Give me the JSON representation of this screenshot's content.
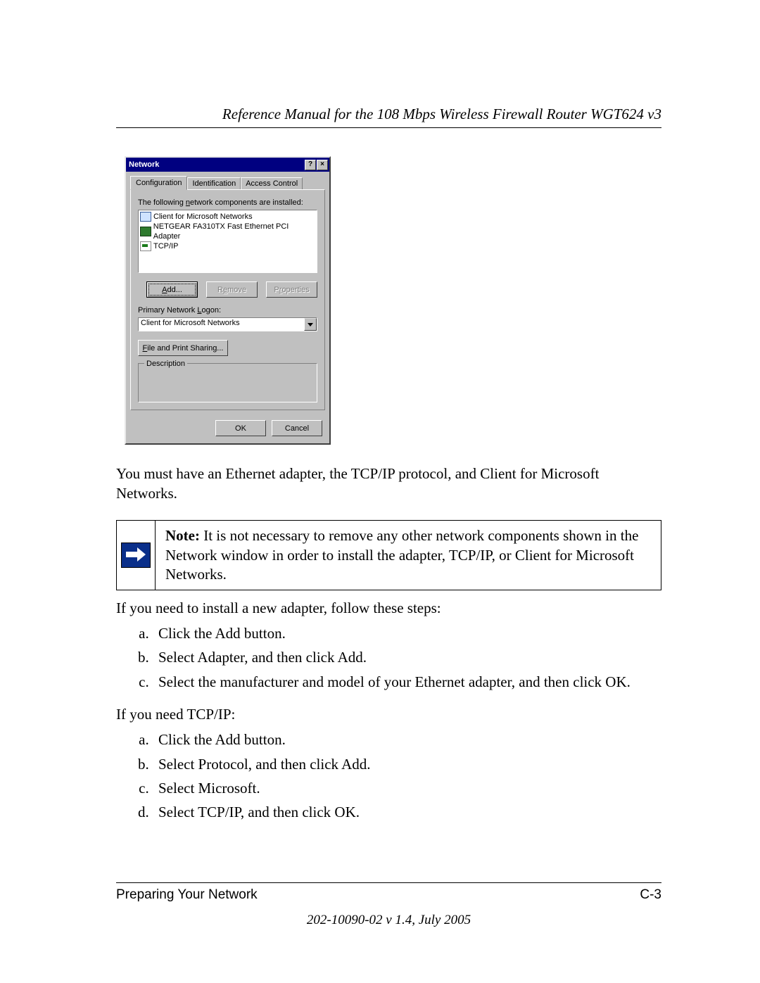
{
  "header": {
    "title": "Reference Manual for the 108 Mbps Wireless Firewall Router WGT624 v3"
  },
  "dialog": {
    "title": "Network",
    "help_glyph": "?",
    "close_glyph": "×",
    "tabs": {
      "t1": "Configuration",
      "t2": "Identification",
      "t3": "Access Control"
    },
    "components_label": "The following network components are installed:",
    "components": {
      "c1": "Client for Microsoft Networks",
      "c2": "NETGEAR FA310TX Fast Ethernet PCI Adapter",
      "c3": "TCP/IP"
    },
    "buttons": {
      "add": "Add...",
      "remove": "Remove",
      "properties": "Properties"
    },
    "primary_logon_label": "Primary Network Logon:",
    "primary_logon_value": "Client for Microsoft Networks",
    "file_print_sharing": "File and Print Sharing...",
    "description_label": "Description",
    "ok": "OK",
    "cancel": "Cancel"
  },
  "body": {
    "p1": "You must have an Ethernet adapter, the TCP/IP protocol, and Client for Microsoft Networks.",
    "note_label": "Note:",
    "note_text": " It is not necessary to remove any other network components shown in the Network window in order to install the adapter, TCP/IP, or Client for Microsoft Networks.",
    "p2": "If you need to install a new adapter, follow these steps:",
    "list1": {
      "a": "Click the Add button.",
      "b": "Select Adapter, and then click Add.",
      "c": "Select the manufacturer and model of your Ethernet adapter, and then click OK."
    },
    "p3": "If you need TCP/IP:",
    "list2": {
      "a": "Click the Add button.",
      "b": "Select Protocol, and then click Add.",
      "c": "Select Microsoft.",
      "d": "Select TCP/IP, and then click OK."
    }
  },
  "footer": {
    "section": "Preparing Your Network",
    "pagenum": "C-3",
    "version": "202-10090-02 v 1.4, July 2005"
  }
}
